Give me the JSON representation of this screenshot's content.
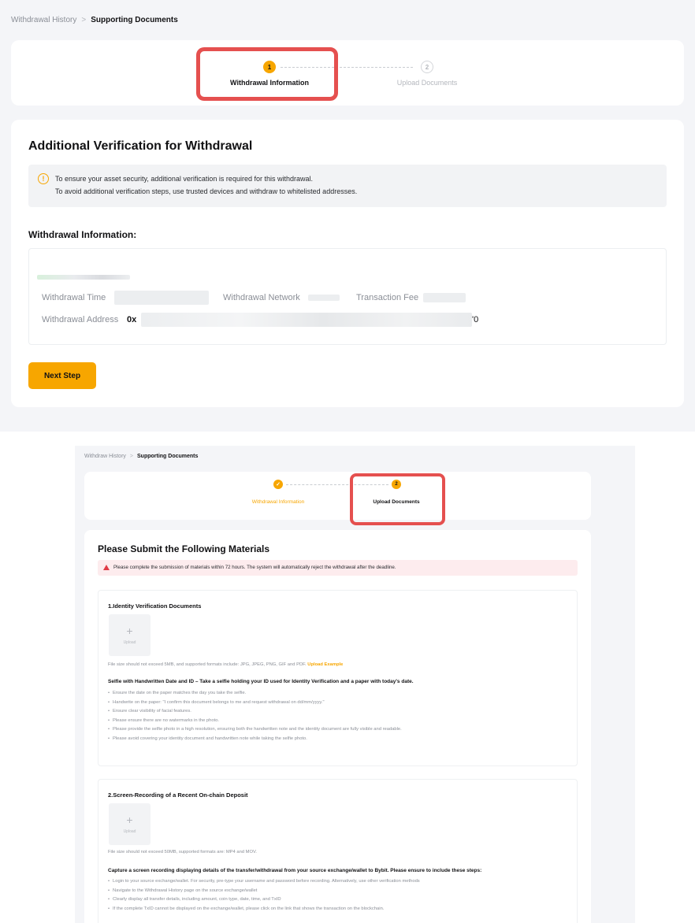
{
  "colors": {
    "accent": "#f7a600",
    "highlight": "#e5504f",
    "danger": "#e03a45",
    "page_bg": "#f4f5f8"
  },
  "top": {
    "breadcrumb": {
      "parent": "Withdrawal History",
      "separator": ">",
      "current": "Supporting Documents"
    },
    "steps": [
      {
        "number": "1",
        "label": "Withdrawal Information",
        "state": "active"
      },
      {
        "number": "2",
        "label": "Upload Documents",
        "state": "upcoming"
      }
    ],
    "title": "Additional Verification for Withdrawal",
    "notice": {
      "icon": "info-circle-icon",
      "lines": [
        "To ensure your asset security, additional verification is required for this withdrawal.",
        "To avoid additional verification steps, use trusted devices and withdraw to whitelisted addresses."
      ]
    },
    "info_heading": "Withdrawal Information:",
    "info": {
      "time_label": "Withdrawal Time",
      "network_label": "Withdrawal Network",
      "fee_label": "Transaction Fee",
      "address_label": "Withdrawal Address",
      "address_prefix": "0x",
      "address_suffix": "'0"
    },
    "next_button": "Next Step"
  },
  "bottom": {
    "breadcrumb": {
      "parent": "Withdraw History",
      "separator": ">",
      "current": "Supporting Documents"
    },
    "steps": [
      {
        "number": "✓",
        "label": "Withdrawal Information",
        "state": "done"
      },
      {
        "number": "2",
        "label": "Upload Documents",
        "state": "active"
      }
    ],
    "title": "Please Submit the Following Materials",
    "alert": "Please complete the submission of materials within 72 hours. The system will automatically reject the withdrawal after the deadline.",
    "sections": [
      {
        "title": "1.Identity Verification Documents",
        "upload_label": "Upload",
        "note": "File size should not exceed 5MB, and supported formats include: JPG, JPEG, PNG, GIF and PDF.",
        "note_link": "Upload Example",
        "instruction": "Selfie with Handwritten Date and ID – Take a selfie holding your ID used for Identity Verification and a paper with today's date.",
        "bullets": [
          "Ensure the date on the paper matches the day you take the selfie.",
          "Handwrite on the paper: \"I confirm this document belongs to me and request withdrawal on dd/mm/yyyy.\"",
          "Ensure clear visibility of facial features.",
          "Please ensure there are no watermarks in the photo.",
          "Please provide the selfie photo in a high resolution, ensuring both the handwritten note and the identity document are fully visible and readable.",
          "Please avoid covering your identity document and handwritten note while taking the selfie photo."
        ]
      },
      {
        "title": "2.Screen-Recording of a Recent On-chain Deposit",
        "upload_label": "Upload",
        "note": "File size should not exceed 50MB, supported formats are: MP4 and MOV.",
        "instruction": "Capture a screen recording displaying details of the transfer/withdrawal from your source exchange/wallet to Bybit. Please ensure to include these steps:",
        "bullets": [
          "Login to your source exchange/wallet. For security, pre-type your username and password before recording. Alternatively, use other verification methods",
          "Navigate to the Withdrawal History page on the source exchange/wallet",
          "Clearly display all transfer details, including amount, coin type, date, time, and TxID",
          "If the complete TxID cannot be displayed on the exchange/wallet, please click on the link that shows the transaction on the blockchain."
        ]
      }
    ]
  }
}
